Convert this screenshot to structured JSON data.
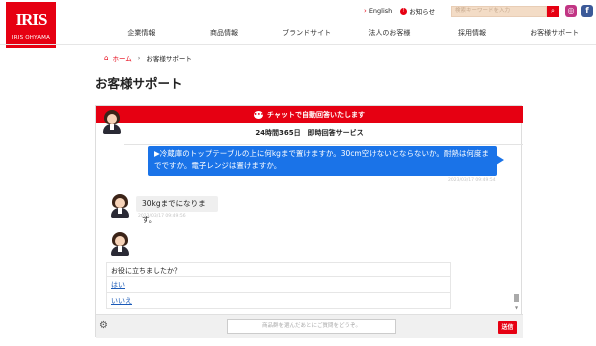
{
  "brand": {
    "logo_mark": "IRIS",
    "logo_sub": "IRIS OHYAMA",
    "accent": "#e60012"
  },
  "toplinks": {
    "english": "English",
    "notice": "お知らせ"
  },
  "search": {
    "placeholder": "検索キーワードを入力"
  },
  "social": {
    "instagram": "instagram-icon",
    "facebook": "facebook-icon"
  },
  "nav": [
    "企業情報",
    "商品情報",
    "ブランドサイト",
    "法人のお客様",
    "採用情報",
    "お客様サポート"
  ],
  "breadcrumb": {
    "home": "ホーム",
    "current": "お客様サポート"
  },
  "page_title": "お客様サポート",
  "chat": {
    "header": "チャットで自動回答いたします",
    "hours": "24時間365日　即時回答サービス",
    "user_message": "▶冷蔵庫のトップテーブルの上に何kgまで置けますか。30cm空けないとならないか。耐熱は何度までですか。電子レンジは置けますか。",
    "user_time": "2023/03/17 09:49:54",
    "bot_message": "30kgまでになります。",
    "bot_time": "2023/03/17 09:49:56",
    "survey_question": "お役に立ちましたか？",
    "survey_yes": "はい",
    "survey_no": "いいえ",
    "input_placeholder": "商品群を選んだあとにご質問をどうぞ。",
    "send_label": "送信"
  }
}
